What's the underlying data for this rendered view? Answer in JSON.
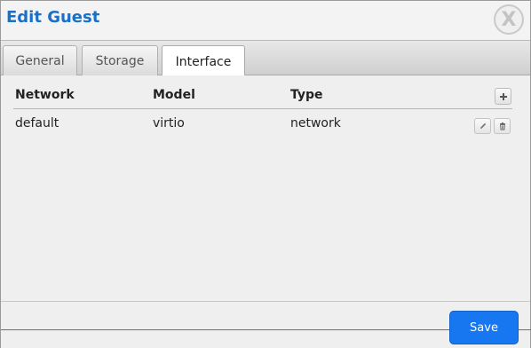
{
  "dialog": {
    "title": "Edit Guest",
    "close_icon": "close-icon",
    "close_glyph": "X"
  },
  "tabs": [
    {
      "label": "General",
      "active": false
    },
    {
      "label": "Storage",
      "active": false
    },
    {
      "label": "Interface",
      "active": true
    }
  ],
  "grid": {
    "columns": [
      "Network",
      "Model",
      "Type"
    ],
    "rows": [
      {
        "network": "default",
        "model": "virtio",
        "type": "network"
      }
    ],
    "add_icon": "plus-icon",
    "edit_icon": "pencil-icon",
    "delete_icon": "trash-icon"
  },
  "footer": {
    "save_label": "Save"
  },
  "colors": {
    "title": "#1a6fc7",
    "save_button": "#1677f0"
  }
}
